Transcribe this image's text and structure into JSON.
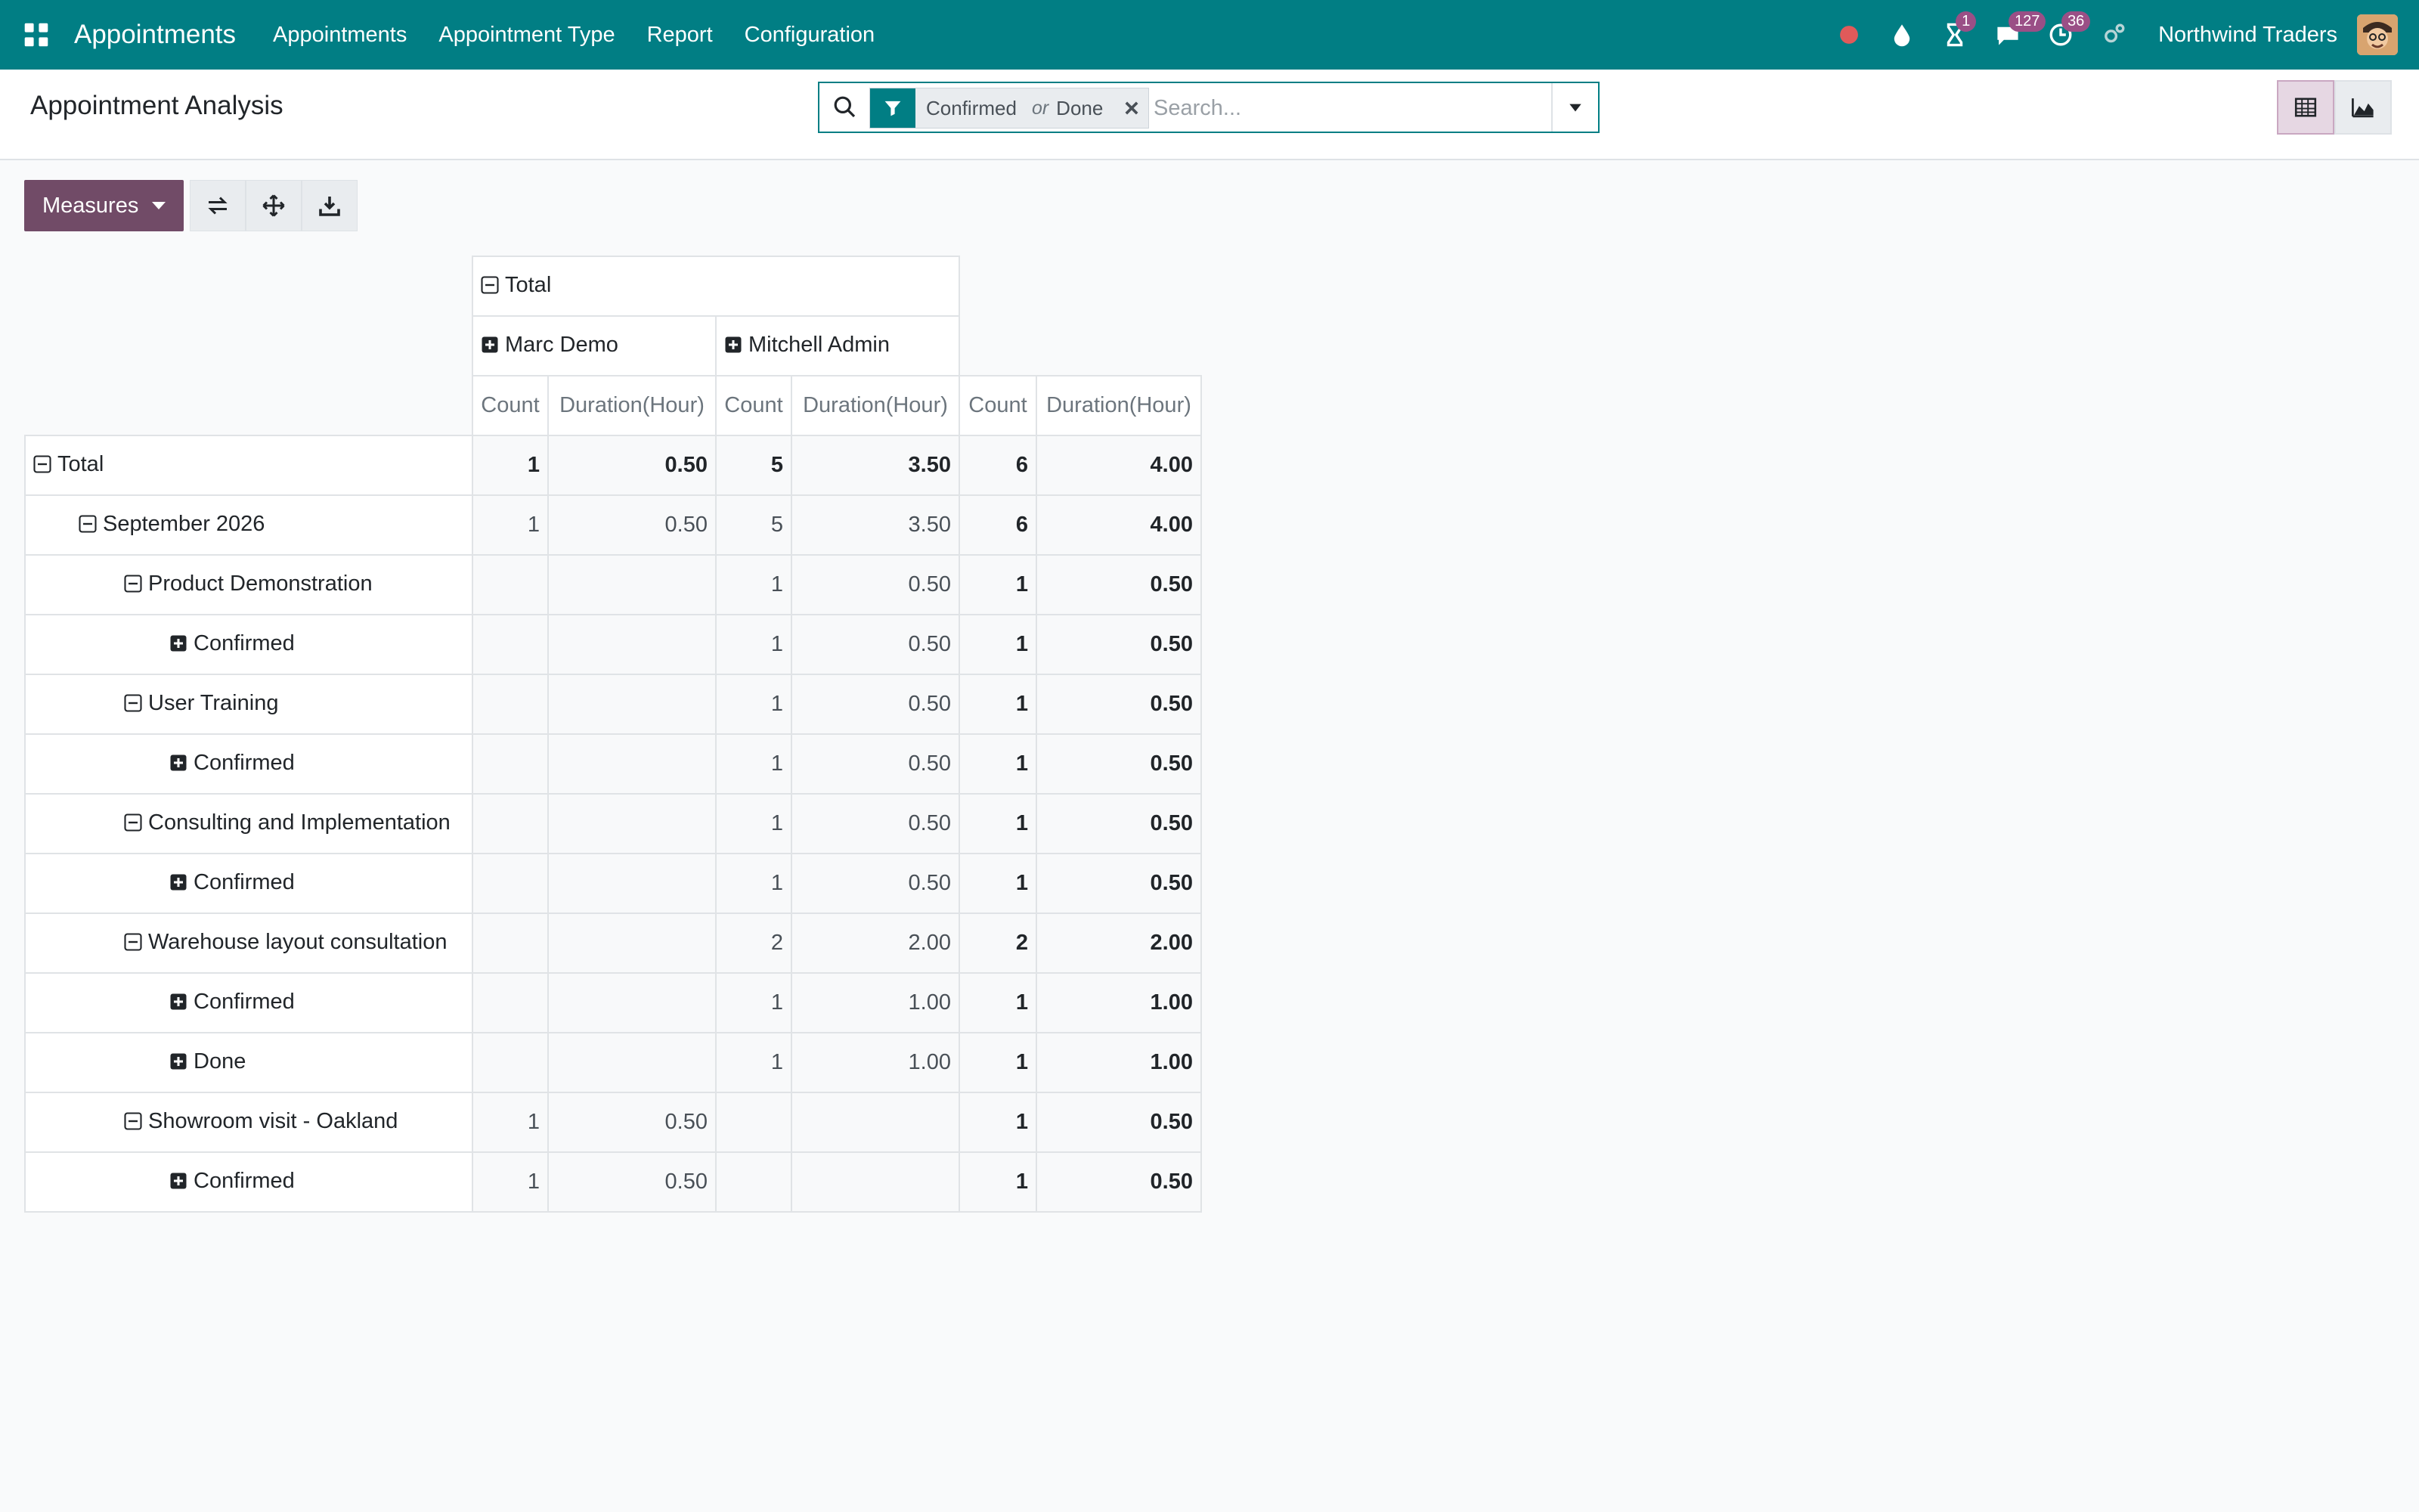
{
  "navbar": {
    "app_name": "Appointments",
    "menu": [
      "Appointments",
      "Appointment Type",
      "Report",
      "Configuration"
    ],
    "badges": {
      "activities": "1",
      "messages": "127",
      "clock": "36"
    },
    "company": "Northwind Traders",
    "colors": {
      "bar": "#017e84",
      "badge": "#9a4f86"
    }
  },
  "control_panel": {
    "title": "Appointment Analysis",
    "facet": {
      "value1": "Confirmed",
      "separator": "or",
      "value2": "Done"
    },
    "search_placeholder": "Search..."
  },
  "toolbar": {
    "measures_label": "Measures"
  },
  "pivot": {
    "col_total": "Total",
    "col_groups": [
      "Marc Demo",
      "Mitchell Admin"
    ],
    "measures": [
      "Count",
      "Duration(Hour)"
    ],
    "rows": [
      {
        "label": "Total",
        "level": 0,
        "icon": "minus",
        "values": [
          "1",
          "0.50",
          "5",
          "3.50",
          "6",
          "4.00"
        ],
        "bold_all": true
      },
      {
        "label": "September 2026",
        "level": 1,
        "icon": "minus",
        "values": [
          "1",
          "0.50",
          "5",
          "3.50",
          "6",
          "4.00"
        ]
      },
      {
        "label": "Product Demonstration",
        "level": 2,
        "icon": "minus",
        "values": [
          "",
          "",
          "1",
          "0.50",
          "1",
          "0.50"
        ]
      },
      {
        "label": "Confirmed",
        "level": 3,
        "icon": "plus",
        "values": [
          "",
          "",
          "1",
          "0.50",
          "1",
          "0.50"
        ]
      },
      {
        "label": "User Training",
        "level": 2,
        "icon": "minus",
        "values": [
          "",
          "",
          "1",
          "0.50",
          "1",
          "0.50"
        ]
      },
      {
        "label": "Confirmed",
        "level": 3,
        "icon": "plus",
        "values": [
          "",
          "",
          "1",
          "0.50",
          "1",
          "0.50"
        ]
      },
      {
        "label": "Consulting and Implementation",
        "level": 2,
        "icon": "minus",
        "values": [
          "",
          "",
          "1",
          "0.50",
          "1",
          "0.50"
        ]
      },
      {
        "label": "Confirmed",
        "level": 3,
        "icon": "plus",
        "values": [
          "",
          "",
          "1",
          "0.50",
          "1",
          "0.50"
        ]
      },
      {
        "label": "Warehouse layout consultation",
        "level": 2,
        "icon": "minus",
        "values": [
          "",
          "",
          "2",
          "2.00",
          "2",
          "2.00"
        ]
      },
      {
        "label": "Confirmed",
        "level": 3,
        "icon": "plus",
        "values": [
          "",
          "",
          "1",
          "1.00",
          "1",
          "1.00"
        ]
      },
      {
        "label": "Done",
        "level": 3,
        "icon": "plus",
        "values": [
          "",
          "",
          "1",
          "1.00",
          "1",
          "1.00"
        ]
      },
      {
        "label": "Showroom visit - Oakland",
        "level": 2,
        "icon": "minus",
        "values": [
          "1",
          "0.50",
          "",
          "",
          "1",
          "0.50"
        ]
      },
      {
        "label": "Confirmed",
        "level": 3,
        "icon": "plus",
        "values": [
          "1",
          "0.50",
          "",
          "",
          "1",
          "0.50"
        ]
      }
    ]
  }
}
